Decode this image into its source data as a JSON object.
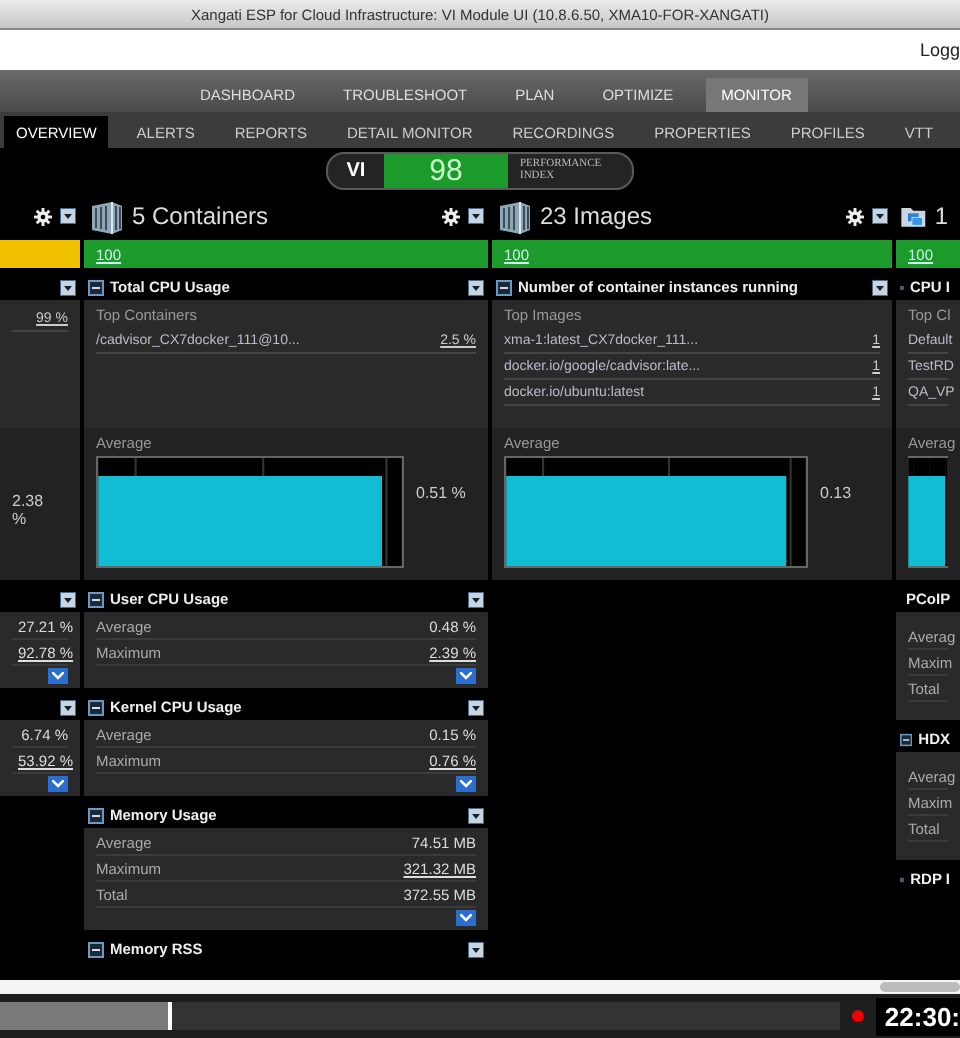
{
  "window": {
    "title": "Xangati ESP for Cloud Infrastructure: VI Module UI (10.8.6.50, XMA10-FOR-XANGATI)"
  },
  "login_link": "Logg",
  "main_tabs": [
    {
      "label": "DASHBOARD",
      "selected": false
    },
    {
      "label": "TROUBLESHOOT",
      "selected": false
    },
    {
      "label": "PLAN",
      "selected": false
    },
    {
      "label": "OPTIMIZE",
      "selected": false
    },
    {
      "label": "MONITOR",
      "selected": true
    }
  ],
  "sub_tabs": [
    {
      "label": "OVERVIEW",
      "selected": true
    },
    {
      "label": "ALERTS",
      "selected": false
    },
    {
      "label": "REPORTS",
      "selected": false
    },
    {
      "label": "DETAIL MONITOR",
      "selected": false
    },
    {
      "label": "RECORDINGS",
      "selected": false
    },
    {
      "label": "PROPERTIES",
      "selected": false
    },
    {
      "label": "PROFILES",
      "selected": false
    },
    {
      "label": "VTT",
      "selected": false
    }
  ],
  "performance_index": {
    "label": "VI",
    "value": "98",
    "caption": "PERFORMANCE INDEX"
  },
  "columns": [
    {
      "controls": true,
      "bar": {
        "color": "#f2c200"
      },
      "sections": [
        {
          "kind": "top-list",
          "items": [
            {
              "value": "99 %"
            }
          ]
        },
        {
          "kind": "average",
          "reading": "2.38 %",
          "chart": false
        },
        {
          "kind": "stats",
          "expandable": true,
          "rows": [
            {
              "value": "27.21 %",
              "link": false
            },
            {
              "value": "92.78 %",
              "link": true
            }
          ]
        },
        {
          "kind": "stats",
          "expandable": true,
          "rows": [
            {
              "value": "6.74 %",
              "link": false
            },
            {
              "value": "53.92 %",
              "link": true
            }
          ]
        }
      ]
    },
    {
      "title": "5 Containers",
      "controls": true,
      "bar": {
        "color": "#1c9a2c",
        "label": "100"
      },
      "sections": [
        {
          "kind": "top-list",
          "title": "Total CPU Usage",
          "subtitle": "Top Containers",
          "items": [
            {
              "name": "/cadvisor_CX7docker_111@10...",
              "value": "2.5 %"
            }
          ]
        },
        {
          "kind": "average",
          "subtitle": "Average",
          "reading": "0.51 %",
          "chart": true
        },
        {
          "kind": "stats",
          "title": "User CPU Usage",
          "expandable": true,
          "rows": [
            {
              "label": "Average",
              "value": "0.48 %",
              "link": false
            },
            {
              "label": "Maximum",
              "value": "2.39 %",
              "link": true
            }
          ]
        },
        {
          "kind": "stats",
          "title": "Kernel CPU Usage",
          "expandable": true,
          "rows": [
            {
              "label": "Average",
              "value": "0.15 %",
              "link": false
            },
            {
              "label": "Maximum",
              "value": "0.76 %",
              "link": true
            }
          ]
        },
        {
          "kind": "stats",
          "title": "Memory Usage",
          "expandable": true,
          "rows": [
            {
              "label": "Average",
              "value": "74.51 MB",
              "link": false
            },
            {
              "label": "Maximum",
              "value": "321.32 MB",
              "link": true
            },
            {
              "label": "Total",
              "value": "372.55 MB",
              "link": false
            }
          ]
        },
        {
          "kind": "header",
          "title": "Memory RSS"
        }
      ]
    },
    {
      "title": "23 Images",
      "controls": true,
      "bar": {
        "color": "#1c9a2c",
        "label": "100"
      },
      "sections": [
        {
          "kind": "top-list",
          "title": "Number of container instances running",
          "subtitle": "Top Images",
          "items": [
            {
              "name": "xma-1:latest_CX7docker_111...",
              "value": "1"
            },
            {
              "name": "docker.io/google/cadvisor:late...",
              "value": "1"
            },
            {
              "name": "docker.io/ubuntu:latest",
              "value": "1"
            }
          ]
        },
        {
          "kind": "average",
          "subtitle": "Average",
          "reading": "0.13",
          "chart": true
        }
      ]
    },
    {
      "title": "1",
      "controls": false,
      "bar": {
        "color": "#1c9a2c",
        "label": "100"
      },
      "sections": [
        {
          "kind": "top-list",
          "title": "CPU I",
          "subtitle": "Top Cl",
          "items": [
            {
              "name": "Default"
            },
            {
              "name": "TestRD"
            },
            {
              "name": "QA_VP"
            }
          ]
        },
        {
          "kind": "average",
          "subtitle": "Averag",
          "chart": true
        },
        {
          "kind": "stats",
          "title": "PCoIP",
          "expandable": false,
          "rows": [
            {
              "label": "Averag"
            },
            {
              "label": "Maxim"
            },
            {
              "label": "Total"
            }
          ]
        },
        {
          "kind": "stats",
          "title": "HDX",
          "expandable": false,
          "rows": [
            {
              "label": "Averag"
            },
            {
              "label": "Maxim"
            },
            {
              "label": "Total"
            }
          ]
        },
        {
          "kind": "header",
          "title": "RDP I"
        }
      ]
    }
  ],
  "timeline": {
    "level": 0.2
  },
  "clock": {
    "time": "22:30:"
  }
}
